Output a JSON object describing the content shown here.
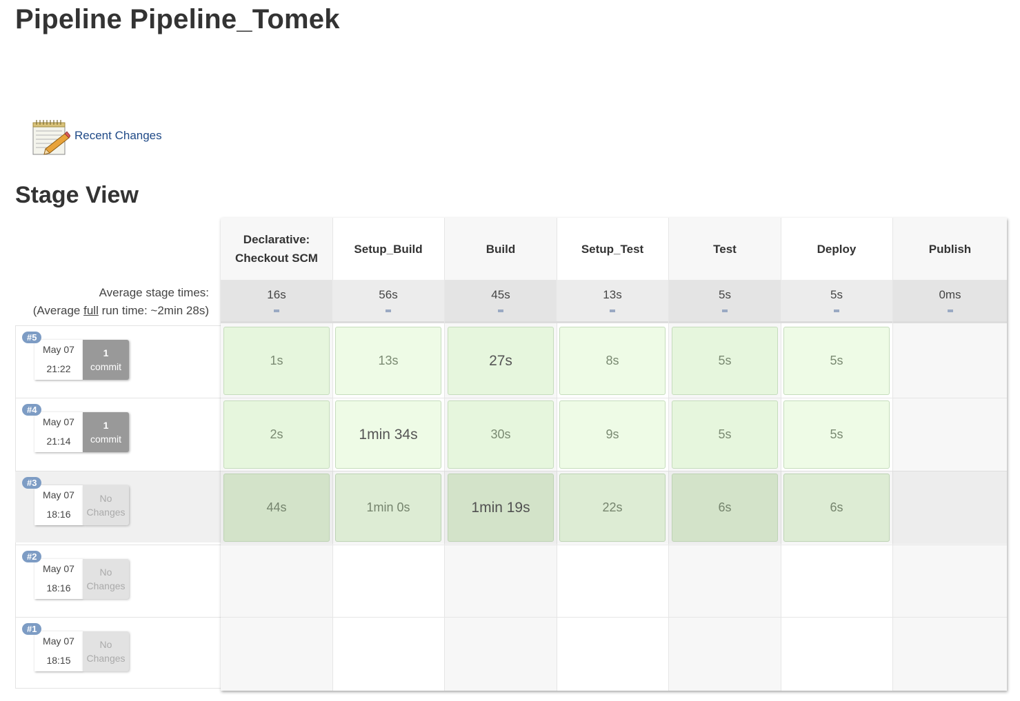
{
  "page": {
    "title": "Pipeline Pipeline_Tomek",
    "recent_changes_label": "Recent Changes",
    "section_title": "Stage View"
  },
  "average": {
    "label_line1": "Average stage times:",
    "label_prefix": "(Average ",
    "label_full": "full",
    "label_suffix": " run time: ~2min 28s)"
  },
  "stages": [
    {
      "name": "Declarative: Checkout SCM",
      "avg": "16s"
    },
    {
      "name": "Setup_Build",
      "avg": "56s"
    },
    {
      "name": "Build",
      "avg": "45s"
    },
    {
      "name": "Setup_Test",
      "avg": "13s"
    },
    {
      "name": "Test",
      "avg": "5s"
    },
    {
      "name": "Deploy",
      "avg": "5s"
    },
    {
      "name": "Publish",
      "avg": "0ms"
    }
  ],
  "runs": [
    {
      "id": "#5",
      "date": "May 07",
      "time": "21:22",
      "changes_count": "1",
      "changes_label": "commit",
      "durations": [
        "1s",
        "13s",
        "27s",
        "8s",
        "5s",
        "5s"
      ]
    },
    {
      "id": "#4",
      "date": "May 07",
      "time": "21:14",
      "changes_count": "1",
      "changes_label": "commit",
      "durations": [
        "2s",
        "1min 34s",
        "30s",
        "9s",
        "5s",
        "5s"
      ]
    },
    {
      "id": "#3",
      "date": "May 07",
      "time": "18:16",
      "changes_label": "No Changes",
      "durations": [
        "44s",
        "1min 0s",
        "1min 19s",
        "22s",
        "6s",
        "6s"
      ]
    },
    {
      "id": "#2",
      "date": "May 07",
      "time": "18:16",
      "changes_label": "No Changes"
    },
    {
      "id": "#1",
      "date": "May 07",
      "time": "18:15",
      "changes_label": "No Changes"
    }
  ]
}
